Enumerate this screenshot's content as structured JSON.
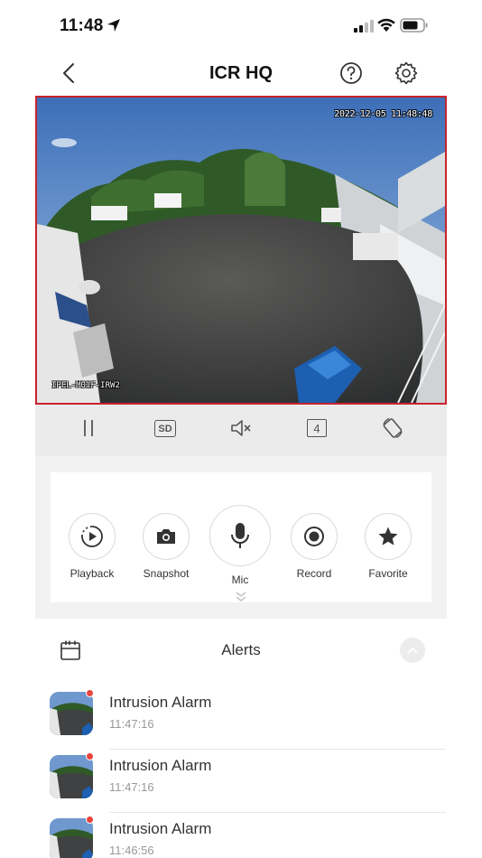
{
  "status_bar": {
    "time": "11:48"
  },
  "nav": {
    "title": "ICR HQ"
  },
  "video": {
    "timestamp": "2022-12-05 11:48:48",
    "camera_label": "IPEL-M01F-IRW2"
  },
  "controls": {
    "stream_quality": "SD",
    "split_count": "4"
  },
  "actions": {
    "playback": "Playback",
    "snapshot": "Snapshot",
    "mic": "Mic",
    "record": "Record",
    "favorite": "Favorite"
  },
  "alerts": {
    "title": "Alerts",
    "items": [
      {
        "name": "Intrusion Alarm",
        "time": "11:47:16"
      },
      {
        "name": "Intrusion Alarm",
        "time": "11:47:16"
      },
      {
        "name": "Intrusion Alarm",
        "time": "11:46:56"
      }
    ]
  },
  "colors": {
    "accent_red": "#c8232c",
    "alert_dot": "#e8453c",
    "control_bar_bg": "#ebebeb",
    "panel_bg": "#f2f2f2"
  }
}
